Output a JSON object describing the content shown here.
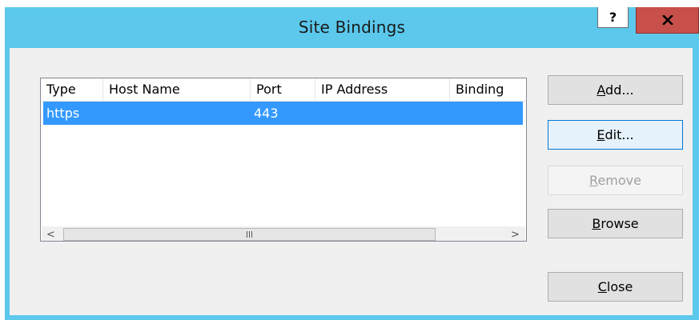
{
  "window": {
    "title": "Site Bindings",
    "help_glyph": "?",
    "close_icon": "close-icon"
  },
  "colors": {
    "titlebar": "#5bc8ec",
    "close_button": "#c7504a",
    "selection": "#3399ff",
    "hover_button": "#e5f1fb"
  },
  "bindings_table": {
    "columns": [
      "Type",
      "Host Name",
      "Port",
      "IP Address",
      "Binding"
    ],
    "rows": [
      {
        "type": "https",
        "host_name": "",
        "port": "443",
        "ip_address": "",
        "binding": ""
      }
    ],
    "scrollbar": {
      "left_arrow": "<",
      "right_arrow": ">"
    }
  },
  "buttons": {
    "add": {
      "label_prefix": "",
      "mnemonic": "A",
      "label_suffix": "dd..."
    },
    "edit": {
      "label_prefix": "",
      "mnemonic": "E",
      "label_suffix": "dit..."
    },
    "remove": {
      "label_prefix": "",
      "mnemonic": "R",
      "label_suffix": "emove"
    },
    "browse": {
      "label_prefix": "",
      "mnemonic": "B",
      "label_suffix": "rowse"
    },
    "close": {
      "label_prefix": "",
      "mnemonic": "C",
      "label_suffix": "lose"
    }
  }
}
